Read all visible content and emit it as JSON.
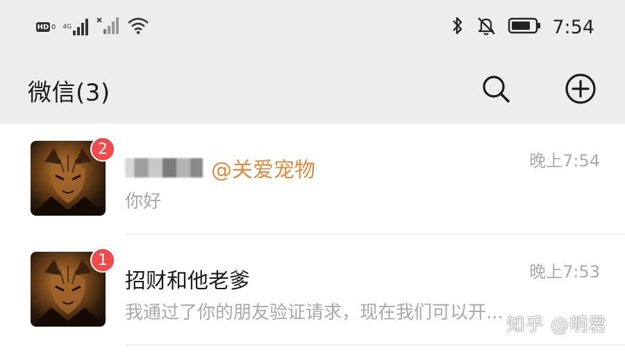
{
  "status_bar": {
    "hd_label": "HD",
    "hd_sub": "0",
    "network_label": "4G",
    "clock": "7:54",
    "icons": [
      "hd-icon",
      "signal-4g-icon",
      "signal-no-sim-icon",
      "wifi-icon",
      "bluetooth-icon",
      "mute-icon",
      "battery-icon"
    ]
  },
  "header": {
    "title": "微信(3)",
    "search_icon": "search-icon",
    "add_icon": "plus-circle-icon"
  },
  "chats": [
    {
      "tag": "@关爱宠物",
      "time": "晚上7:54",
      "preview": "你好",
      "unread": "2"
    },
    {
      "name": "招财和他老爹",
      "time": "晚上7:53",
      "preview": "我通过了你的朋友验证请求，现在我们可以开...",
      "unread": "1"
    }
  ],
  "watermark": "知乎 @明君",
  "colors": {
    "header_bg": "#ededed",
    "badge": "#f04a4a",
    "tag": "#e08a3c",
    "muted_text": "#a8a8a8"
  }
}
